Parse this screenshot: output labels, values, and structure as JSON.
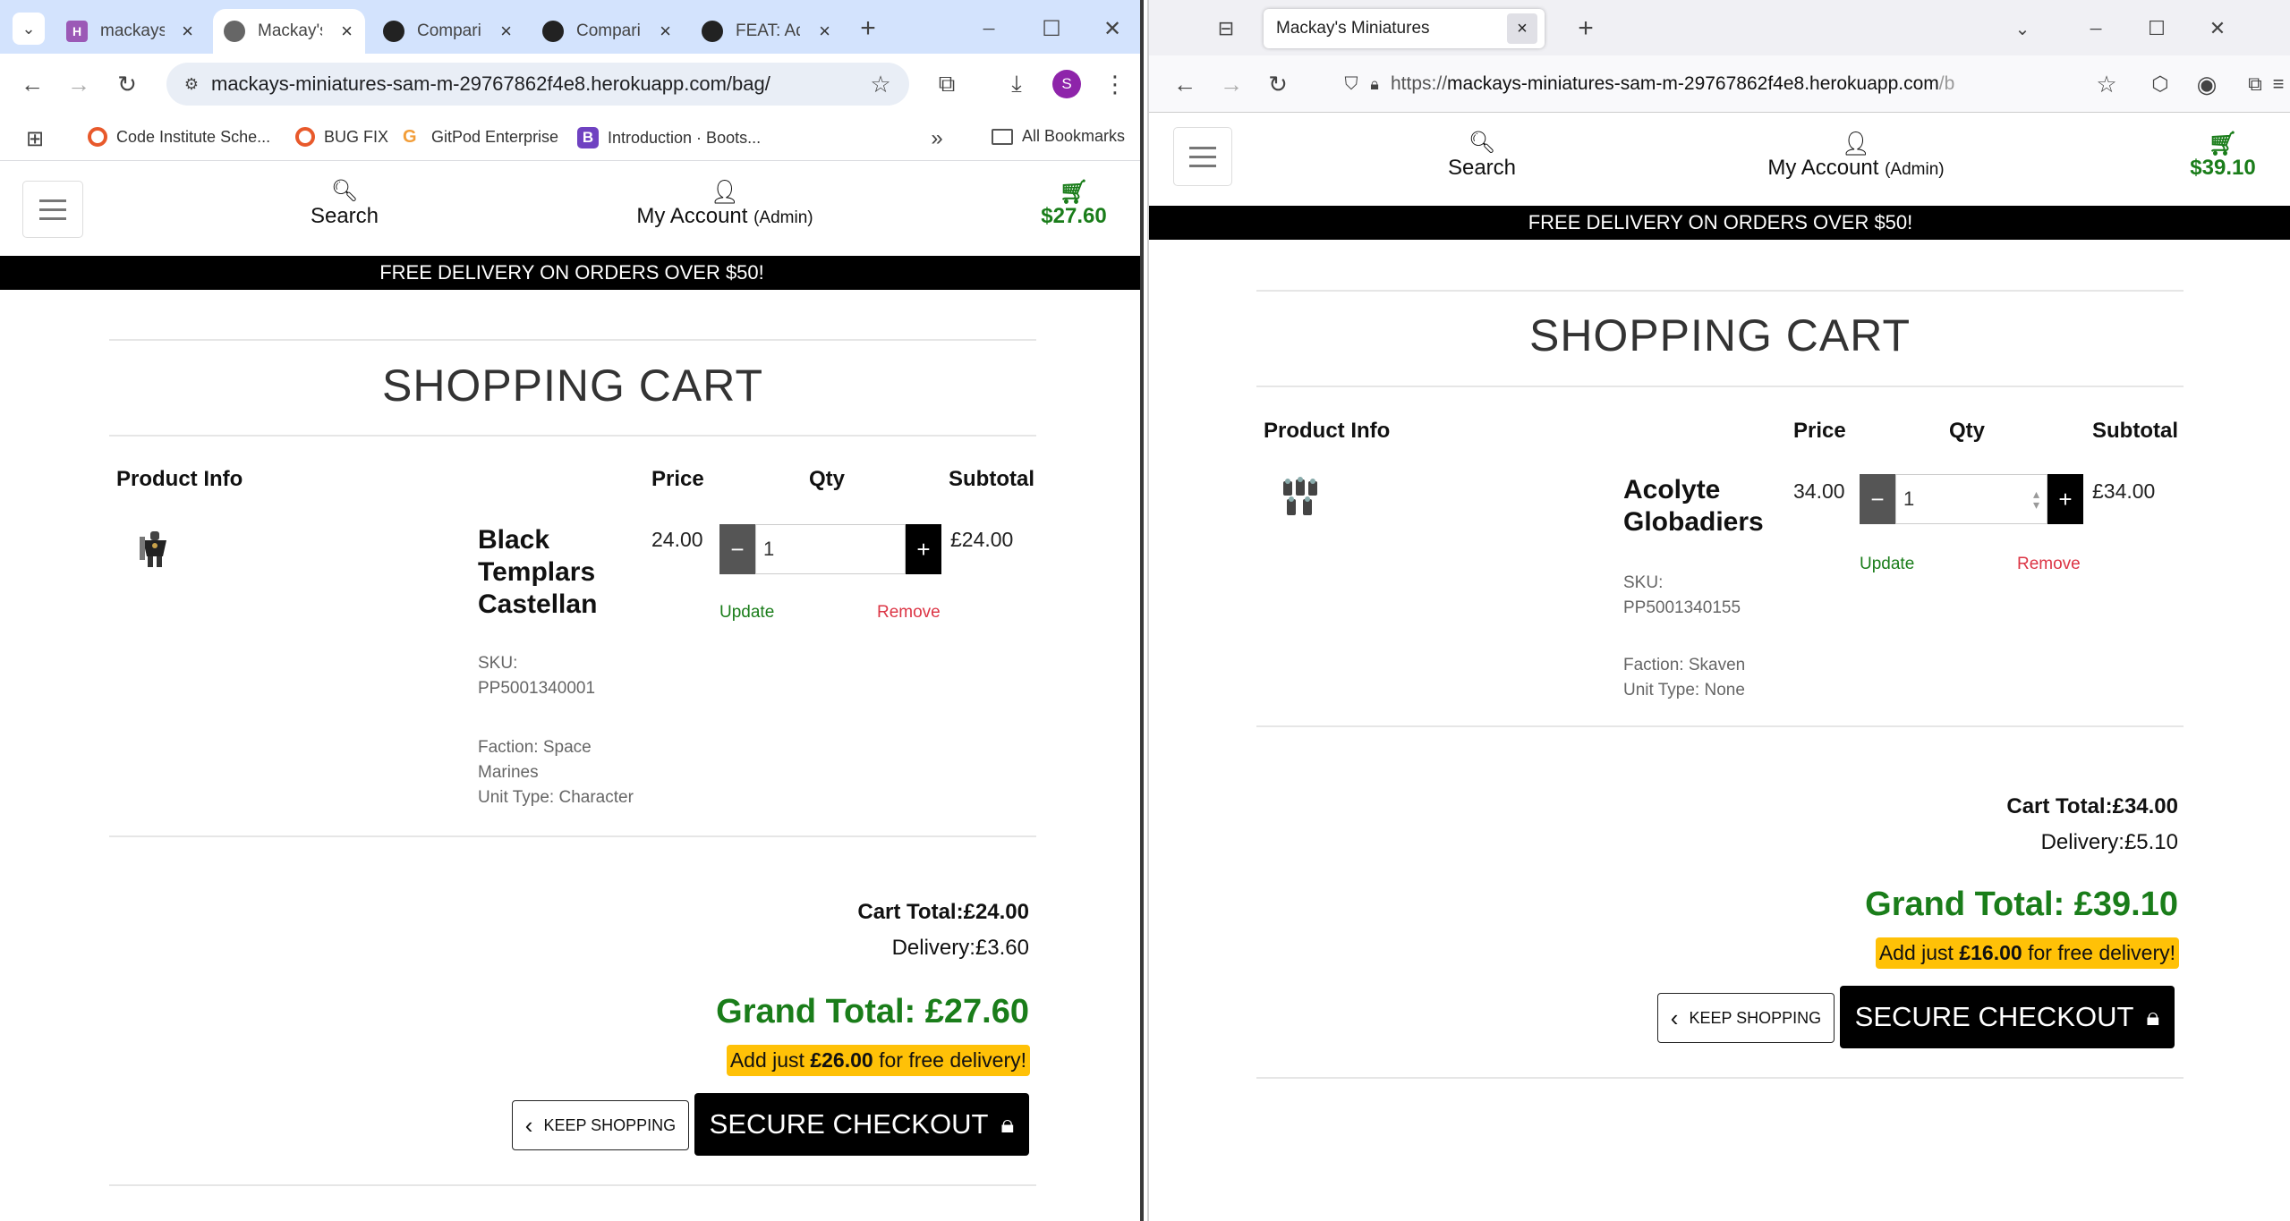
{
  "left": {
    "tabs": [
      {
        "label": "mackays",
        "active": false,
        "fav_color": "#9b59b6",
        "icon": "heroku-icon"
      },
      {
        "label": "Mackay's",
        "active": true,
        "fav_color": "#555555",
        "icon": "globe-icon"
      },
      {
        "label": "Compari",
        "active": false,
        "fav_color": "#222222",
        "icon": "github-icon"
      },
      {
        "label": "Compari",
        "active": false,
        "fav_color": "#222222",
        "icon": "github-icon"
      },
      {
        "label": "FEAT: Ad",
        "active": false,
        "fav_color": "#222222",
        "icon": "github-icon"
      }
    ],
    "url": "mackays-miniatures-sam-m-29767862f4e8.herokuapp.com/bag/",
    "profile_initial": "S",
    "bookmarks": [
      {
        "label": "Code Institute Sche...",
        "icon": "ci-icon",
        "color": "#e8592b"
      },
      {
        "label": "BUG FIX",
        "icon": "ci-icon",
        "color": "#e8592b"
      },
      {
        "label": "GitPod Enterprise",
        "icon": "gitpod-icon",
        "color": "#f29d38"
      },
      {
        "label": "Introduction · Boots...",
        "icon": "bootstrap-icon",
        "color": "#6f42c1"
      }
    ],
    "all_bookmarks": "All Bookmarks",
    "cart_total_header": "$27.60",
    "product": {
      "name": "Black Templars Castellan",
      "name_lines": [
        "Black",
        "Templars",
        "Castellan"
      ],
      "sku_label": "SKU:",
      "sku": "PP5001340001",
      "faction_lines": [
        "Faction: Space",
        "Marines"
      ],
      "unit_type": "Unit Type: Character",
      "price": "24.00",
      "qty": "1",
      "subtotal": "£24.00"
    },
    "cart_total": "£24.00",
    "delivery": "£3.60",
    "grand_total": "Grand Total: £27.60",
    "free_amount": "£26.00"
  },
  "right": {
    "tab_title": "Mackay's Miniatures",
    "url_prefix": "https://",
    "url_host": "mackays-miniatures-sam-m-29767862f4e8.herokuapp.com",
    "url_rest": "/b",
    "cart_total_header": "$39.10",
    "product": {
      "name_lines": [
        "Acolyte",
        "Globadiers"
      ],
      "sku_label": "SKU:",
      "sku": "PP5001340155",
      "faction": "Faction: Skaven",
      "unit_type": "Unit Type: None",
      "price": "34.00",
      "qty": "1",
      "subtotal": "£34.00"
    },
    "cart_total": "£34.00",
    "delivery": "£5.10",
    "grand_total": "Grand Total: £39.10",
    "free_amount": "£16.00"
  },
  "common": {
    "search": "Search",
    "my_account": "My Account",
    "admin": "(Admin)",
    "banner": "FREE DELIVERY ON ORDERS OVER $50!",
    "title": "SHOPPING CART",
    "col_product": "Product Info",
    "col_price": "Price",
    "col_qty": "Qty",
    "col_subtotal": "Subtotal",
    "update": "Update",
    "remove": "Remove",
    "cart_total_label": "Cart Total:",
    "delivery_label": "Delivery:",
    "free_prefix": "Add just ",
    "free_suffix": " for free delivery!",
    "keep_shopping": "KEEP SHOPPING",
    "secure_checkout": "SECURE CHECKOUT",
    "minus": "−",
    "plus": "+",
    "keep_glyph": "‹",
    "min_glyph": "─",
    "max_glyph": "☐",
    "close_glyph": "✕",
    "newtab_glyph": "+",
    "overflow_glyph": "»"
  },
  "colors": {
    "brand_green": "#1a7d1a",
    "remove_red": "#dc3545",
    "free_yellow": "#ffc107",
    "chrome_tabbar": "#d3e3fd"
  }
}
